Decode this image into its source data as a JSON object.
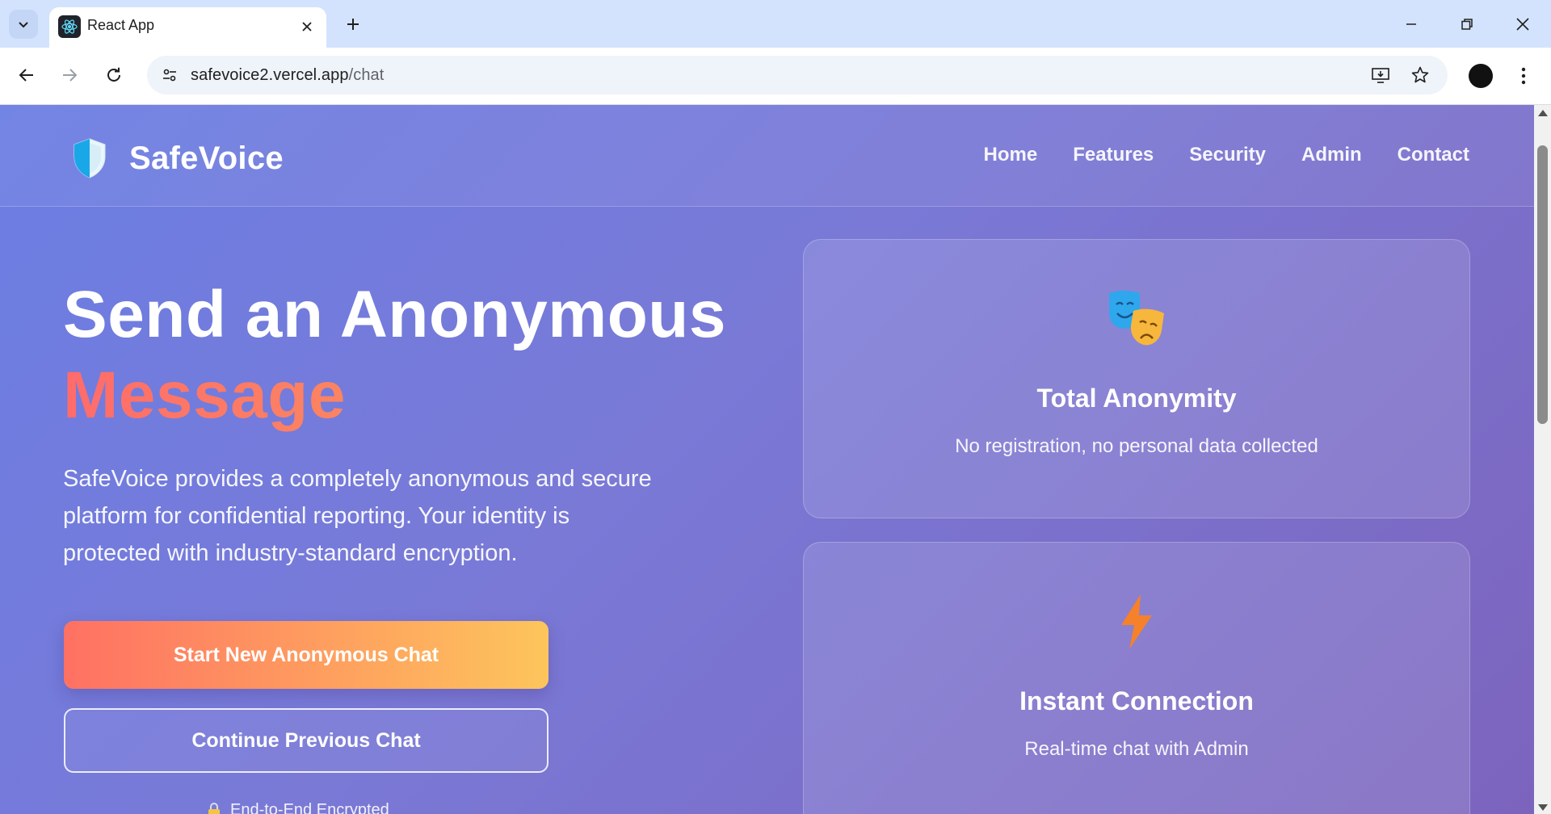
{
  "browser": {
    "tab_title": "React App",
    "url_host": "safevoice2.vercel.app",
    "url_path": "/chat",
    "icons": [
      "tab-list-icon",
      "react-favicon-icon",
      "close-icon",
      "plus-icon",
      "minimize-icon",
      "restore-icon",
      "window-close-icon",
      "back-arrow-icon",
      "forward-arrow-icon",
      "reload-icon",
      "site-info-icon",
      "install-app-icon",
      "star-icon",
      "profile-avatar",
      "menu-dots-icon"
    ]
  },
  "header": {
    "brand": "SafeVoice",
    "nav": [
      "Home",
      "Features",
      "Security",
      "Admin",
      "Contact"
    ]
  },
  "hero": {
    "title_line1": "Send an Anonymous",
    "title_line2": "Message",
    "description": "SafeVoice provides a completely anonymous and secure platform for confidential reporting. Your identity is protected with industry-standard encryption.",
    "primary_button": "Start New Anonymous Chat",
    "secondary_button": "Continue Previous Chat",
    "footnote": "End-to-End Encrypted"
  },
  "features": [
    {
      "icon": "theater-masks-icon",
      "title": "Total Anonymity",
      "description": "No registration, no personal data collected"
    },
    {
      "icon": "lightning-bolt-icon",
      "title": "Instant Connection",
      "description": "Real-time chat with Admin"
    }
  ],
  "colors": {
    "page_gradient_start": "#6b7ee3",
    "page_gradient_end": "#7c64bd",
    "accent_gradient_start": "#ff6b6b",
    "accent_gradient_end": "#fdc55c",
    "tab_strip": "#d3e3fd"
  }
}
